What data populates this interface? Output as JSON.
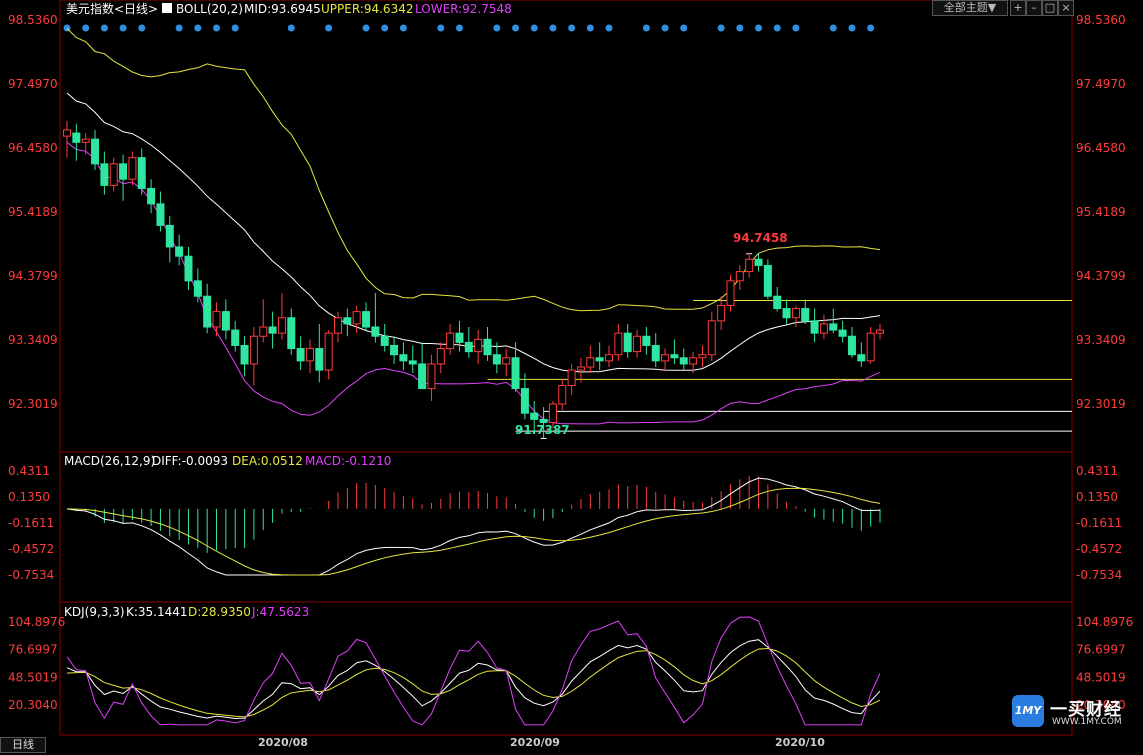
{
  "colors": {
    "up": "#ff3b3b",
    "down": "#2ee6a0",
    "mid": "#ffffff",
    "upper": "#e6e640",
    "lower": "#e040fb",
    "axis": "#ff3b3b",
    "text": "#ffffff",
    "dot": "#2f8fe0",
    "guide": "#ffffff",
    "guideYellow": "#e6e640"
  },
  "toolbar": {
    "theme_button": "全部主题",
    "theme_arrow": "▼",
    "btn_icons": [
      "crosshair-icon",
      "minimize-icon",
      "restore-icon",
      "close-icon"
    ]
  },
  "panels": {
    "main": {
      "title": "美元指数<日线>",
      "indicator": "BOLL(20,2)",
      "mid": "MID:93.6945",
      "upper": "UPPER:94.6342",
      "lower": "LOWER:92.7548",
      "ticks": [
        "98.5360",
        "97.4970",
        "96.4580",
        "95.4189",
        "94.3799",
        "93.3409",
        "92.3019"
      ],
      "ylim": [
        91.52,
        98.536
      ],
      "high_label": "94.7458",
      "low_label": "91.7387"
    },
    "macd": {
      "indicator": "MACD(26,12,9)",
      "diff": "DIFF:-0.0093",
      "dea": "DEA:0.0512",
      "macd": "MACD:-0.1210",
      "ticks": [
        "0.4311",
        "0.1350",
        "-0.1611",
        "-0.4572",
        "-0.7534"
      ]
    },
    "kdj": {
      "indicator": "KDJ(9,3,3)",
      "k": "K:35.1441",
      "d": "D:28.9350",
      "j": "J:47.5623",
      "ticks": [
        "104.8976",
        "76.6997",
        "48.5019",
        "20.3040"
      ]
    }
  },
  "x_labels": [
    "2020/08",
    "2020/09",
    "2020/10"
  ],
  "period_button": "日线",
  "watermark": {
    "brand": "一买财经",
    "site": "WWW.1MY.COM",
    "badge": "1MY"
  },
  "chart_data": {
    "type": "candlestick",
    "ohlc": [
      [
        96.65,
        96.9,
        96.3,
        96.75
      ],
      [
        96.7,
        96.85,
        96.25,
        96.55
      ],
      [
        96.55,
        96.7,
        96.35,
        96.6
      ],
      [
        96.6,
        96.75,
        96.1,
        96.2
      ],
      [
        96.2,
        96.4,
        95.7,
        95.85
      ],
      [
        95.85,
        96.3,
        95.75,
        96.2
      ],
      [
        96.2,
        96.35,
        95.6,
        95.95
      ],
      [
        95.95,
        96.4,
        95.85,
        96.3
      ],
      [
        96.3,
        96.45,
        95.7,
        95.8
      ],
      [
        95.8,
        95.95,
        95.4,
        95.55
      ],
      [
        95.55,
        95.75,
        95.1,
        95.2
      ],
      [
        95.2,
        95.35,
        94.6,
        94.85
      ],
      [
        94.85,
        95.05,
        94.55,
        94.7
      ],
      [
        94.7,
        94.85,
        94.15,
        94.3
      ],
      [
        94.3,
        94.5,
        93.95,
        94.05
      ],
      [
        94.05,
        94.25,
        93.45,
        93.55
      ],
      [
        93.55,
        93.95,
        93.4,
        93.8
      ],
      [
        93.8,
        94.0,
        93.35,
        93.5
      ],
      [
        93.5,
        93.65,
        93.15,
        93.25
      ],
      [
        93.25,
        93.4,
        92.75,
        92.95
      ],
      [
        92.95,
        93.55,
        92.6,
        93.4
      ],
      [
        93.4,
        94.0,
        93.3,
        93.55
      ],
      [
        93.55,
        93.8,
        93.2,
        93.45
      ],
      [
        93.45,
        94.1,
        93.35,
        93.7
      ],
      [
        93.7,
        93.85,
        93.1,
        93.2
      ],
      [
        93.2,
        93.4,
        92.85,
        93.0
      ],
      [
        93.0,
        93.35,
        92.8,
        93.2
      ],
      [
        93.2,
        93.6,
        92.65,
        92.85
      ],
      [
        92.85,
        93.5,
        92.7,
        93.45
      ],
      [
        93.45,
        93.8,
        93.3,
        93.7
      ],
      [
        93.7,
        93.85,
        93.4,
        93.6
      ],
      [
        93.6,
        93.9,
        93.45,
        93.8
      ],
      [
        93.8,
        93.95,
        93.5,
        93.55
      ],
      [
        93.55,
        94.1,
        93.3,
        93.4
      ],
      [
        93.4,
        93.6,
        93.15,
        93.25
      ],
      [
        93.25,
        93.4,
        92.95,
        93.1
      ],
      [
        93.1,
        93.3,
        92.85,
        93.0
      ],
      [
        93.0,
        93.25,
        92.8,
        92.95
      ],
      [
        92.95,
        93.3,
        92.55,
        92.55
      ],
      [
        92.55,
        93.1,
        92.35,
        92.95
      ],
      [
        92.95,
        93.3,
        92.8,
        93.2
      ],
      [
        93.2,
        93.6,
        93.1,
        93.45
      ],
      [
        93.45,
        93.65,
        93.15,
        93.3
      ],
      [
        93.3,
        93.55,
        93.05,
        93.15
      ],
      [
        93.15,
        93.5,
        92.95,
        93.35
      ],
      [
        93.35,
        93.55,
        93.0,
        93.1
      ],
      [
        93.1,
        93.3,
        92.8,
        92.95
      ],
      [
        92.95,
        93.2,
        92.75,
        93.05
      ],
      [
        93.05,
        93.3,
        92.5,
        92.55
      ],
      [
        92.55,
        92.8,
        92.05,
        92.15
      ],
      [
        92.15,
        92.35,
        91.85,
        92.05
      ],
      [
        92.05,
        92.25,
        91.74,
        92.0
      ],
      [
        92.0,
        92.35,
        91.9,
        92.3
      ],
      [
        92.3,
        92.7,
        92.2,
        92.6
      ],
      [
        92.6,
        92.95,
        92.45,
        92.85
      ],
      [
        92.85,
        93.05,
        92.65,
        92.9
      ],
      [
        92.9,
        93.25,
        92.8,
        93.05
      ],
      [
        93.05,
        93.3,
        92.85,
        93.0
      ],
      [
        93.0,
        93.25,
        92.9,
        93.1
      ],
      [
        93.1,
        93.6,
        93.0,
        93.45
      ],
      [
        93.45,
        93.6,
        93.05,
        93.15
      ],
      [
        93.15,
        93.5,
        93.05,
        93.4
      ],
      [
        93.4,
        93.55,
        93.1,
        93.25
      ],
      [
        93.25,
        93.45,
        92.9,
        93.0
      ],
      [
        93.0,
        93.2,
        92.85,
        93.1
      ],
      [
        93.1,
        93.35,
        92.95,
        93.05
      ],
      [
        93.05,
        93.2,
        92.85,
        92.95
      ],
      [
        92.95,
        93.15,
        92.8,
        93.05
      ],
      [
        93.05,
        93.25,
        92.9,
        93.1
      ],
      [
        93.1,
        93.8,
        93.0,
        93.65
      ],
      [
        93.65,
        94.05,
        93.5,
        93.9
      ],
      [
        93.9,
        94.4,
        93.8,
        94.3
      ],
      [
        94.3,
        94.55,
        94.15,
        94.45
      ],
      [
        94.45,
        94.75,
        94.35,
        94.65
      ],
      [
        94.65,
        94.75,
        94.45,
        94.55
      ],
      [
        94.55,
        94.65,
        94.0,
        94.05
      ],
      [
        94.05,
        94.2,
        93.8,
        93.85
      ],
      [
        93.85,
        94.0,
        93.6,
        93.7
      ],
      [
        93.7,
        93.9,
        93.55,
        93.85
      ],
      [
        93.85,
        94.0,
        93.6,
        93.65
      ],
      [
        93.65,
        93.85,
        93.3,
        93.45
      ],
      [
        93.45,
        93.75,
        93.35,
        93.6
      ],
      [
        93.6,
        93.85,
        93.45,
        93.5
      ],
      [
        93.5,
        93.65,
        93.3,
        93.4
      ],
      [
        93.4,
        93.55,
        93.05,
        93.1
      ],
      [
        93.1,
        93.3,
        92.9,
        93.0
      ],
      [
        93.0,
        93.55,
        92.95,
        93.45
      ],
      [
        93.45,
        93.6,
        93.35,
        93.5
      ]
    ],
    "xlabel": "",
    "ylabel": "",
    "legend": "top-left"
  }
}
